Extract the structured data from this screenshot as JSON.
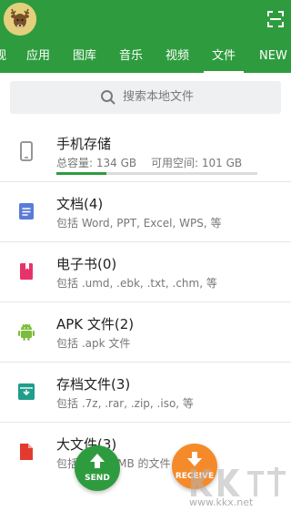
{
  "header": {
    "tabs": [
      {
        "label": "视"
      },
      {
        "label": "应用"
      },
      {
        "label": "图库"
      },
      {
        "label": "音乐"
      },
      {
        "label": "视频"
      },
      {
        "label": "文件",
        "active": true
      },
      {
        "label": "NEW"
      }
    ]
  },
  "search": {
    "placeholder": "搜索本地文件"
  },
  "storage": {
    "title": "手机存储",
    "total": "总容量: 134 GB",
    "free": "可用空间: 101 GB",
    "used_fraction": 0.25
  },
  "categories": [
    {
      "title": "文档(4)",
      "desc": "包括 Word, PPT, Excel, WPS, 等",
      "icon": "document-icon",
      "color": "#5a7bd8"
    },
    {
      "title": "电子书(0)",
      "desc": "包括 .umd, .ebk, .txt, .chm, 等",
      "icon": "ebook-icon",
      "color": "#e8336a"
    },
    {
      "title": "APK 文件(2)",
      "desc": "包括 .apk 文件",
      "icon": "android-icon",
      "color": "#7dbb3e"
    },
    {
      "title": "存档文件(3)",
      "desc": "包括 .7z, .rar, .zip, .iso, 等",
      "icon": "archive-icon",
      "color": "#1f9e8c"
    },
    {
      "title": "大文件(3)",
      "desc": "包括大于50 MB 的文件",
      "icon": "large-file-icon",
      "color": "#e23b2e"
    }
  ],
  "actions": {
    "send_label": "SEND",
    "receive_label": "RECEIVE",
    "send_color": "#2e9c3e",
    "receive_color": "#f58a2a"
  },
  "watermark": {
    "text": "www.kkx.net"
  }
}
